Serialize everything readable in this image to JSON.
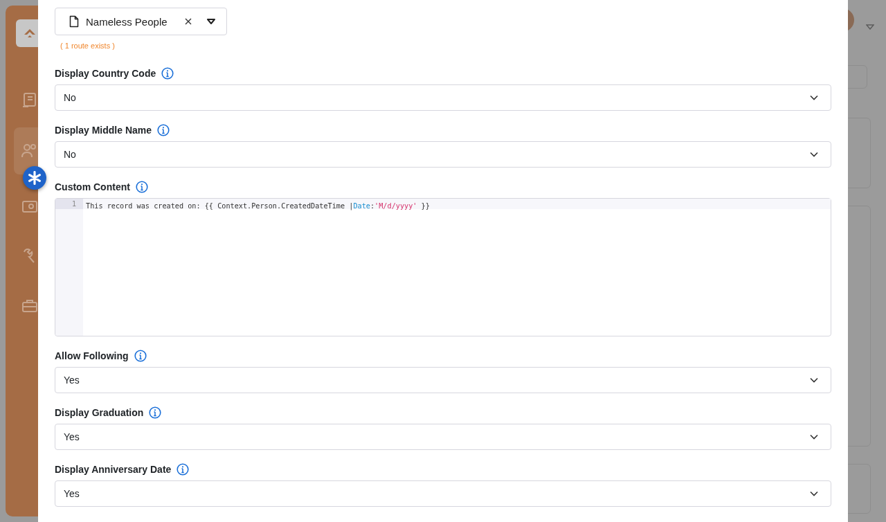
{
  "page_selector": {
    "value": "Nameless People",
    "hint": "( 1 route exists )"
  },
  "fields": [
    {
      "kind": "select",
      "label": "Display Country Code",
      "value": "No"
    },
    {
      "kind": "select",
      "label": "Display Middle Name",
      "value": "No"
    },
    {
      "kind": "code",
      "label": "Custom Content",
      "line_number": "1",
      "code": [
        {
          "kind": "plain",
          "text": "This record was created on: {{ Context.Person.CreatedDateTime |"
        },
        {
          "kind": "keyword",
          "text": "Date"
        },
        {
          "kind": "plain",
          "text": ":"
        },
        {
          "kind": "string",
          "text": "'M/d/yyyy'"
        },
        {
          "kind": "plain",
          "text": " }}"
        }
      ]
    },
    {
      "kind": "select",
      "label": "Allow Following",
      "value": "Yes"
    },
    {
      "kind": "select",
      "label": "Display Graduation",
      "value": "Yes"
    },
    {
      "kind": "select",
      "label": "Display Anniversary Date",
      "value": "Yes"
    }
  ]
}
